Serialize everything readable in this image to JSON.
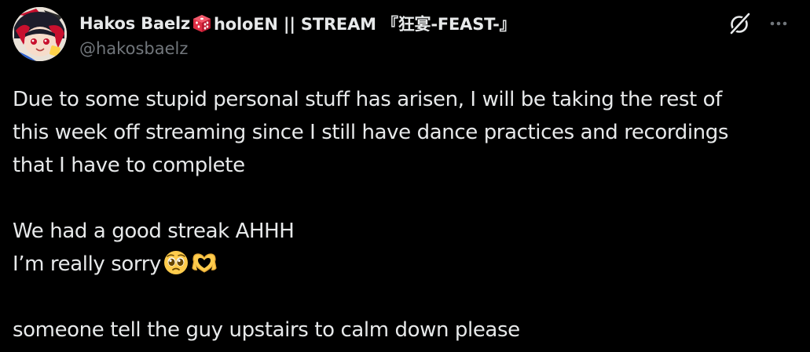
{
  "author": {
    "display_name_part1": "Hakos Baelz",
    "display_name_part2": "holoEN || STREAM 『狂宴-FEAST-』",
    "handle": "@hakosbaelz",
    "avatar_icon": "avatar-image",
    "name_emoji": "game-die-icon"
  },
  "actions": {
    "grok_icon": "grok-icon",
    "more_icon": "more-icon"
  },
  "tweet": {
    "line1": "Due to some stupid personal stuff has arisen, I will be taking the rest of",
    "line2": "this week off streaming since I still have dance practices and recordings",
    "line3": "that I have to complete",
    "line4": "We had a good streak AHHH",
    "line5": "I’m really sorry",
    "line5_emojis": [
      "pleading-face-icon",
      "heart-hands-icon"
    ],
    "line6": "someone tell the guy upstairs to calm down please"
  },
  "colors": {
    "background": "#000000",
    "text_primary": "#e7e9ea",
    "text_secondary": "#71767b"
  }
}
